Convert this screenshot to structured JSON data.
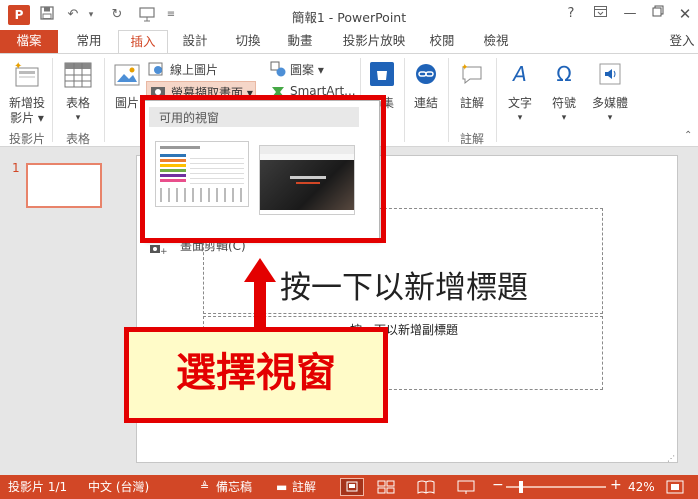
{
  "app": {
    "window_title": "簡報1 - PowerPoint",
    "help": "?",
    "signin": "登入"
  },
  "tabs": {
    "file": "檔案",
    "items": [
      "常用",
      "插入",
      "設計",
      "切換",
      "動畫",
      "投影片放映",
      "校閱",
      "檢視"
    ],
    "active": "插入"
  },
  "ribbon": {
    "new_slide": "新增投影片",
    "new_slide_line1": "新增投",
    "new_slide_line2": "影片",
    "table": "表格",
    "pictures": "圖片",
    "online_pictures": "線上圖片",
    "screenshot": "螢幕擷取畫面",
    "shapes": "圖案",
    "smartart": "SmartArt...",
    "store": "市集",
    "links": "連結",
    "comment": "註解",
    "text": "文字",
    "symbols": "符號",
    "media": "多媒體",
    "groups": {
      "slides": "投影片",
      "tables": "表格",
      "comments": "註解"
    }
  },
  "dropdown": {
    "header": "可用的視窗",
    "clip": "畫面剪輯(C)"
  },
  "slide_panel": {
    "number": "1"
  },
  "slide": {
    "title_placeholder": "按一下以新增標題",
    "subtitle_placeholder": "按一下以新增副標題"
  },
  "annotation": {
    "text": "選擇視窗"
  },
  "status": {
    "slide_counter": "投影片 1/1",
    "language": "中文 (台灣)",
    "notes": "備忘稿",
    "comments": "註解",
    "zoom": "42%"
  },
  "colors": {
    "accent": "#d24726",
    "highlight": "#e30000",
    "callout_bg": "#fffbc8"
  }
}
